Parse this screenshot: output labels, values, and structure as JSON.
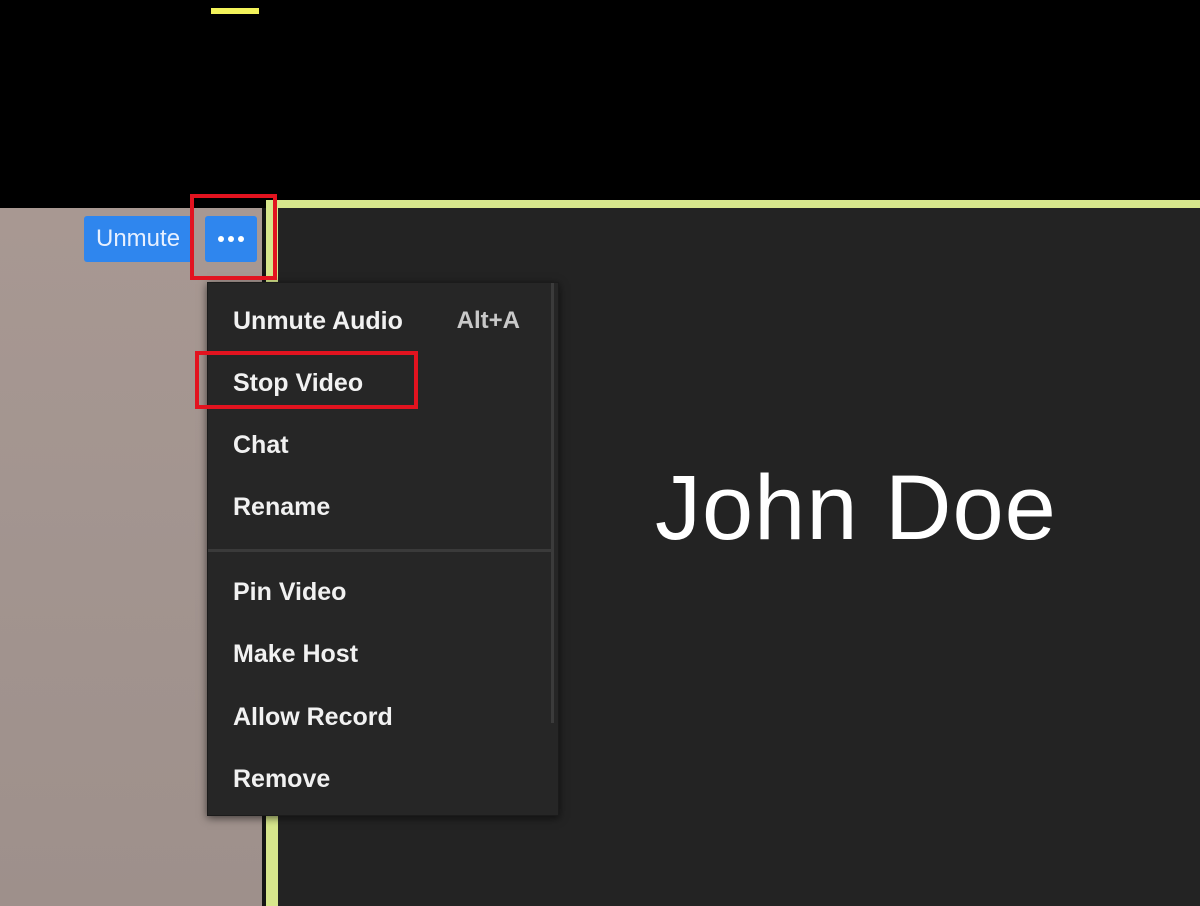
{
  "meeting": {
    "speaker_name": "John Doe"
  },
  "hover_controls": {
    "unmute_label": "Unmute",
    "more_icon": "more-horizontal-icon"
  },
  "context_menu": {
    "items": [
      {
        "label": "Unmute Audio",
        "shortcut": "Alt+A"
      },
      {
        "label": "Stop Video",
        "shortcut": ""
      },
      {
        "label": "Chat",
        "shortcut": ""
      },
      {
        "label": "Rename",
        "shortcut": ""
      },
      {
        "label": "Pin Video",
        "shortcut": ""
      },
      {
        "label": "Make Host",
        "shortcut": ""
      },
      {
        "label": "Allow Record",
        "shortcut": ""
      },
      {
        "label": "Remove",
        "shortcut": ""
      }
    ]
  },
  "colors": {
    "accent_blue": "#2f86ee",
    "highlight_red": "#e2131f",
    "active_speaker_border": "#d7e68c",
    "menu_background": "#262626"
  }
}
